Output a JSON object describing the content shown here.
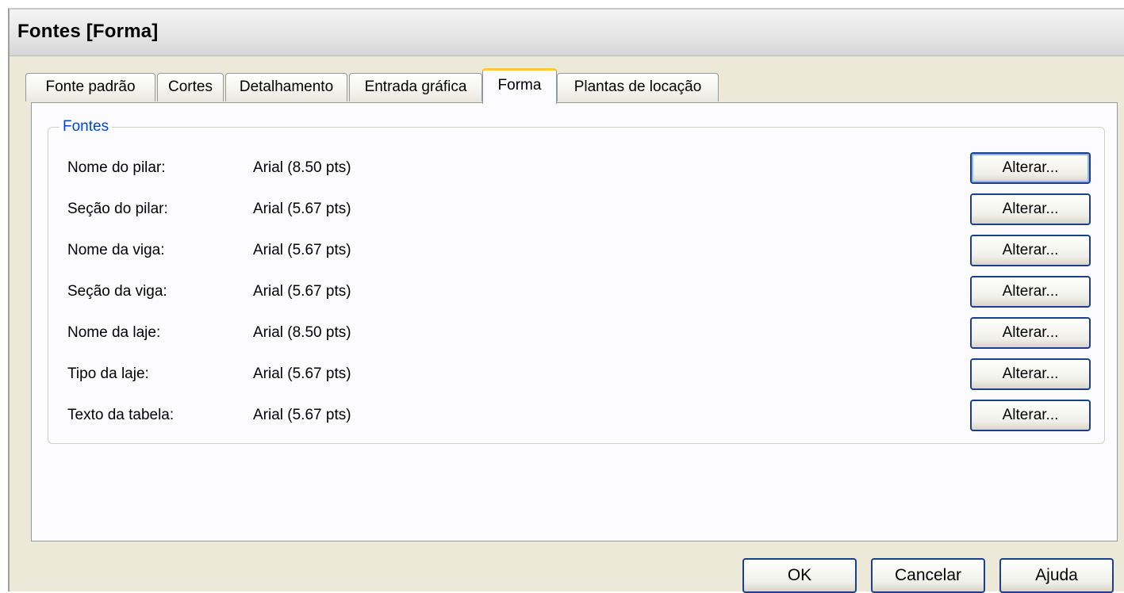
{
  "window": {
    "title": "Fontes [Forma]"
  },
  "tabs": [
    {
      "label": "Fonte padrão"
    },
    {
      "label": "Cortes"
    },
    {
      "label": "Detalhamento"
    },
    {
      "label": "Entrada gráfica"
    },
    {
      "label": "Forma",
      "active": true
    },
    {
      "label": "Plantas de locação"
    }
  ],
  "fonts_group": {
    "legend": "Fontes",
    "rows": [
      {
        "label": "Nome do pilar:",
        "value": "Arial (8.50 pts)",
        "button": "Alterar..."
      },
      {
        "label": "Seção do pilar:",
        "value": "Arial (5.67 pts)",
        "button": "Alterar..."
      },
      {
        "label": "Nome da viga:",
        "value": "Arial (5.67 pts)",
        "button": "Alterar..."
      },
      {
        "label": "Seção da viga:",
        "value": "Arial (5.67 pts)",
        "button": "Alterar..."
      },
      {
        "label": "Nome da laje:",
        "value": "Arial (8.50 pts)",
        "button": "Alterar..."
      },
      {
        "label": "Tipo da laje:",
        "value": "Arial (5.67 pts)",
        "button": "Alterar..."
      },
      {
        "label": "Texto da tabela:",
        "value": "Arial (5.67 pts)",
        "button": "Alterar..."
      }
    ]
  },
  "buttons": {
    "ok": "OK",
    "cancel": "Cancelar",
    "help": "Ajuda"
  },
  "colors": {
    "legend": "#0046d5",
    "active_tab_accent": "#ffc83c",
    "button_border": "#1c3f8c"
  }
}
